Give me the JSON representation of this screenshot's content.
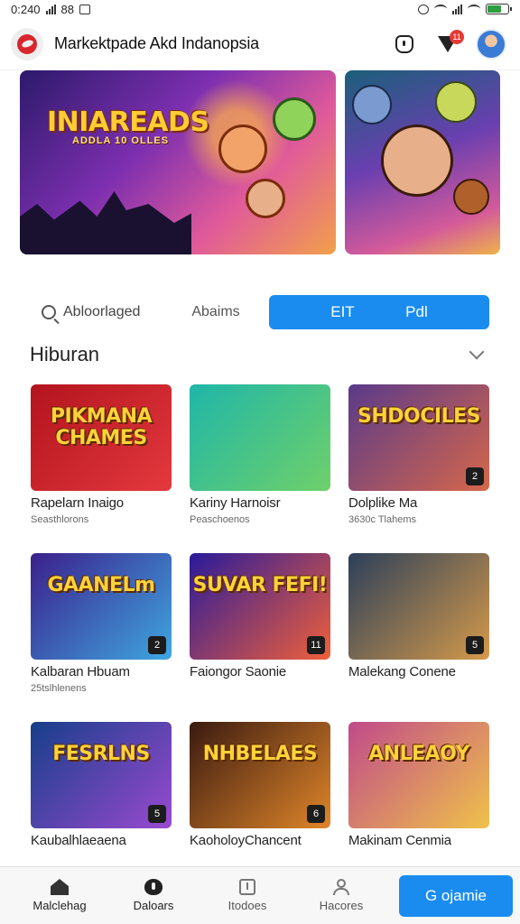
{
  "status_bar": {
    "time": "0:240",
    "carrier": "88"
  },
  "header": {
    "title": "Markektpade Akd Indanopsia",
    "filter_badge": "11"
  },
  "banners": {
    "main_title": "INIAREADS",
    "main_subtitle": "ADDLA 10 OLLES"
  },
  "tabs": {
    "search_label": "Abloorlaged",
    "tab_2": "Abaims",
    "active_left": "EIT",
    "active_right": "Pdl"
  },
  "section": {
    "title": "Hiburan"
  },
  "games": [
    {
      "art": "PIKMANA CHAMES",
      "title": "Rapelarn Inaigo",
      "subtitle": "Seasthlorons",
      "corner": "",
      "colors": [
        "#b3141e",
        "#e4383e"
      ]
    },
    {
      "art": "",
      "title": "Kariny Harnoisr",
      "subtitle": "Peaschoenos",
      "corner": "",
      "colors": [
        "#1fb6a8",
        "#6fd06a"
      ]
    },
    {
      "art": "SHDOCILES",
      "title": "Dolplike Ma",
      "subtitle": "3630c Tlahems",
      "corner": "2",
      "colors": [
        "#5a3a8a",
        "#d6674a"
      ]
    },
    {
      "art": "GAANELm",
      "title": "Kalbaran Hbuam",
      "subtitle": "25tslhlenens",
      "corner": "2",
      "colors": [
        "#3b1f8c",
        "#3fa7e0"
      ]
    },
    {
      "art": "SUVAR FEFI!",
      "title": "Faiongor Saonie",
      "subtitle": "",
      "corner": "11",
      "colors": [
        "#2a1a9a",
        "#f0603a"
      ]
    },
    {
      "art": "",
      "title": "Malekang Conene",
      "subtitle": "",
      "corner": "5",
      "colors": [
        "#2c3f5a",
        "#d59a4a"
      ]
    },
    {
      "art": "FESRLNS",
      "title": "Kaubalhlaeaena",
      "subtitle": "",
      "corner": "5",
      "colors": [
        "#173e8a",
        "#9a4ad0"
      ]
    },
    {
      "art": "NHBELAES",
      "title": "KaoholoyChancent",
      "subtitle": "",
      "corner": "6",
      "colors": [
        "#3a1a10",
        "#e0862a"
      ]
    },
    {
      "art": "ANLEAOY",
      "title": "Makinam Cenmia",
      "subtitle": "",
      "corner": "",
      "colors": [
        "#c04a8a",
        "#f0c24a"
      ]
    }
  ],
  "bottom_nav": {
    "items": [
      {
        "label": "Malclehag",
        "icon": "home-icon"
      },
      {
        "label": "Daloars",
        "icon": "heart-icon"
      },
      {
        "label": "Itodoes",
        "icon": "box-icon"
      },
      {
        "label": "Hacores",
        "icon": "user-icon"
      }
    ],
    "cta_label": "G ojamie"
  },
  "colors": {
    "accent": "#1a8cf0",
    "badge": "#e53935",
    "battery": "#2e9d3f"
  }
}
